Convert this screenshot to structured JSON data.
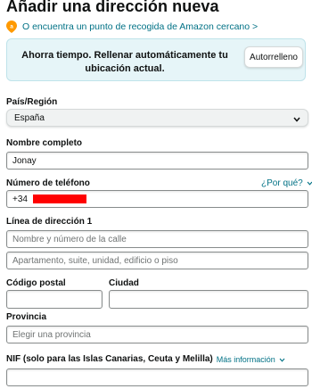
{
  "header": {
    "title": "Añadir una dirección nueva",
    "pickup_link": "O encuentra un punto de recogida de Amazon cercano >"
  },
  "banner": {
    "text": "Ahorra tiempo. Rellenar automáticamente tu ubicación actual.",
    "autofill_button": "Autorrelleno"
  },
  "form": {
    "country_label": "País/Región",
    "country_value": "España",
    "fullname_label": "Nombre completo",
    "fullname_value": "Jonay",
    "phone_label": "Número de teléfono",
    "phone_help": "¿Por qué?",
    "phone_value": "+34",
    "address_label": "Línea de dirección 1",
    "address1_placeholder": "Nombre y número de la calle",
    "address2_placeholder": "Apartamento, suite, unidad, edificio o piso",
    "postal_label": "Código postal",
    "city_label": "Ciudad",
    "province_label": "Provincia",
    "province_placeholder": "Elegir una provincia",
    "nif_label": "NIF (solo para las Islas Canarias, Ceuta y Melilla)",
    "nif_more": "Más información"
  },
  "colors": {
    "link": "#007185",
    "banner_bg": "#e6f5f8",
    "pin": "#ff9900",
    "redaction": "#ff0000"
  }
}
